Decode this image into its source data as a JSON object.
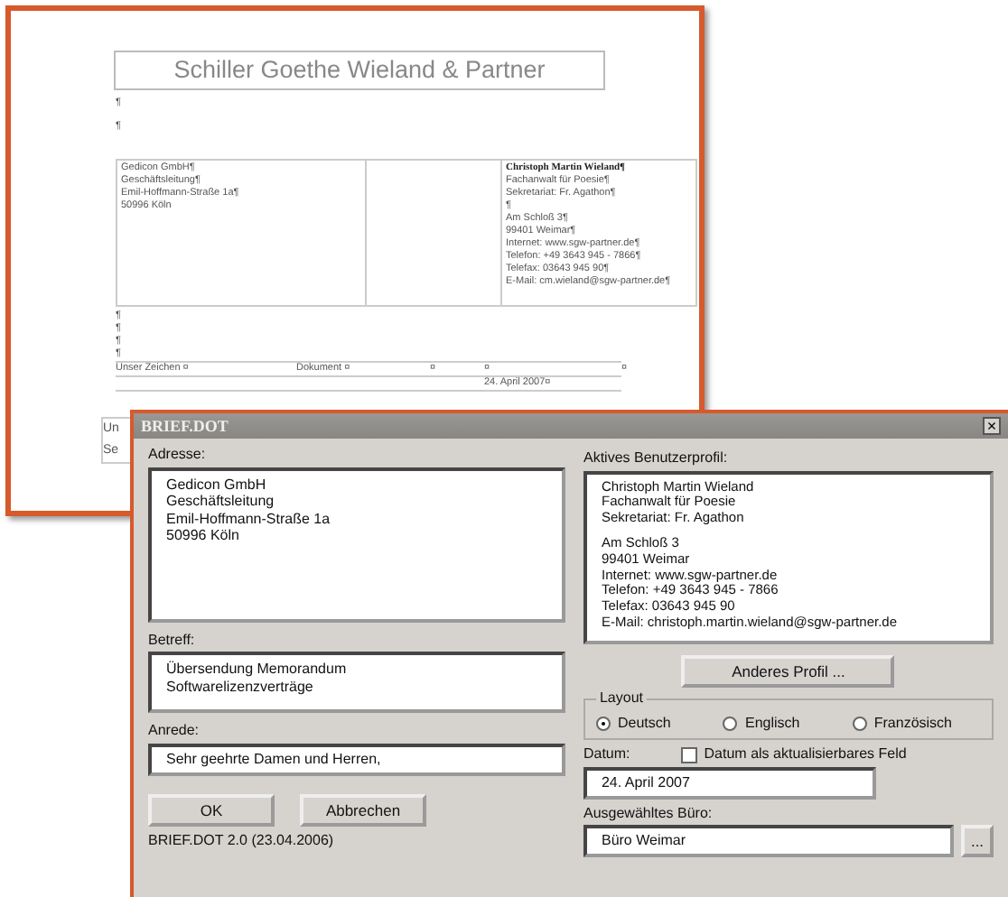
{
  "document": {
    "letterhead": "Schiller Goethe Wieland & Partner",
    "marks_after_letterhead": [
      "¶",
      "¶"
    ],
    "recipient_lines": [
      "Gedicon GmbH¶",
      "Geschäftsleitung¶",
      "Emil-Hoffmann-Straße 1a¶",
      "50996 Köln"
    ],
    "sender_lines": [
      {
        "text": "Christoph Martin Wieland¶",
        "bold": true
      },
      {
        "text": "Fachanwalt für Poesie¶",
        "bold": false
      },
      {
        "text": "Sekretariat: Fr. Agathon¶",
        "bold": false
      },
      {
        "text": "¶",
        "bold": false
      },
      {
        "text": "Am Schloß 3¶",
        "bold": false
      },
      {
        "text": "99401 Weimar¶",
        "bold": false
      },
      {
        "text": "Internet: www.sgw-partner.de¶",
        "bold": false
      },
      {
        "text": "Telefon: +49 3643 945 - 7866¶",
        "bold": false
      },
      {
        "text": "Telefax: 03643 945 90¶",
        "bold": false
      },
      {
        "text": "E-Mail: cm.wieland@sgw-partner.de¶",
        "bold": false
      }
    ],
    "marks_after_address": [
      "¶",
      "¶",
      "¶",
      "¶"
    ],
    "reference_cells": [
      "Unser Zeichen ¤",
      "Dokument ¤",
      "¤",
      "¤",
      "¤"
    ],
    "date_cell": "24. April 2007¤",
    "covered_lines": [
      "Un",
      "Se"
    ]
  },
  "dialog": {
    "title": "BRIEF.DOT",
    "close": "×",
    "address": {
      "label": "Adresse:",
      "lines": [
        "Gedicon GmbH",
        "Geschäftsleitung",
        "Emil-Hoffmann-Straße 1a",
        "50996 Köln"
      ]
    },
    "profile": {
      "label": "Aktives Benutzerprofil:",
      "lines": [
        "Christoph Martin Wieland",
        "Fachanwalt für Poesie",
        "Sekretariat: Fr. Agathon"
      ],
      "contact_lines": [
        "Am Schloß 3",
        "99401 Weimar",
        "Internet: www.sgw-partner.de",
        "Telefon: +49 3643 945 - 7866",
        "Telefax: 03643 945 90",
        "E-Mail: christoph.martin.wieland@sgw-partner.de"
      ]
    },
    "subject": {
      "label": "Betreff:",
      "lines": [
        "Übersendung Memorandum",
        "Softwarelizenzverträge"
      ]
    },
    "profile_button": "Anderes Profil ...",
    "layout": {
      "label": "Layout",
      "options": [
        {
          "label": "Deutsch",
          "selected": true
        },
        {
          "label": "Englisch",
          "selected": false
        },
        {
          "label": "Französisch",
          "selected": false
        }
      ]
    },
    "salutation": {
      "label": "Anrede:",
      "value": "Sehr geehrte Damen und Herren,"
    },
    "date": {
      "label": "Datum:",
      "value": "24. April 2007",
      "checkbox": {
        "label": "Datum als aktualisierbares Feld",
        "checked": false
      }
    },
    "office": {
      "label": "Ausgewähltes Büro:",
      "value": "Büro Weimar",
      "browse_button": "..."
    },
    "buttons": [
      "OK",
      "Abbrechen"
    ],
    "footer": "BRIEF.DOT 2.0 (23.04.2006)"
  }
}
